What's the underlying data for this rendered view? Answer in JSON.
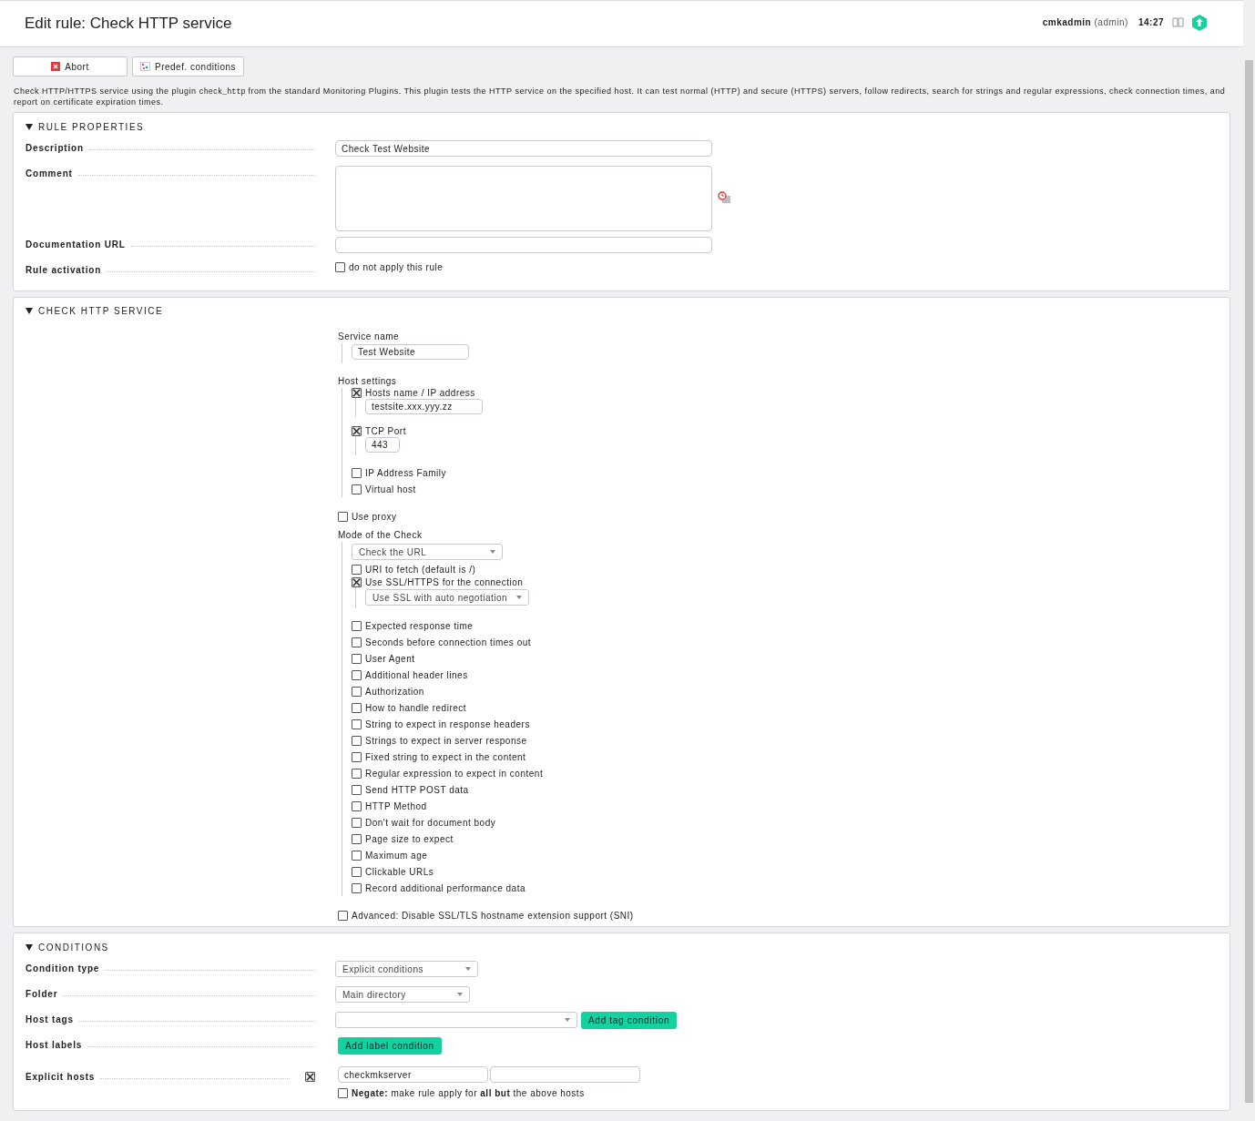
{
  "header": {
    "title": "Edit rule: Check HTTP service",
    "user": "cmkadmin",
    "role": "(admin)",
    "time": "14:27"
  },
  "buttons": [
    {
      "kind": "abort",
      "label": "Abort"
    },
    {
      "kind": "conditions",
      "label": "Predef. conditions"
    }
  ],
  "intro": {
    "before": "Check HTTP/HTTPS service using the plugin ",
    "code": "check_http",
    "after": " from the standard Monitoring Plugins. This plugin tests the HTTP service on the specified host. It can test normal (HTTP) and secure (HTTPS) servers, follow redirects, search for strings and regular expressions, check connection times, and report on certificate expiration times."
  },
  "rule_properties": {
    "title": "RULE PROPERTIES",
    "expanded": true,
    "description": {
      "label": "Description",
      "value": "Check Test Website"
    },
    "comment": {
      "label": "Comment"
    },
    "documentation_url": {
      "label": "Documentation URL"
    },
    "rule_activation": {
      "label": "Rule activation",
      "option": "do not apply this rule",
      "checked": false
    }
  },
  "check_http": {
    "title": "CHECK HTTP SERVICE",
    "expanded": true,
    "service_name": {
      "label": "Service name",
      "value": "Test Website"
    },
    "host_settings": {
      "label": "Host settings",
      "options": [
        {
          "label": "Hosts name / IP address",
          "checked": true,
          "value": "testsite.xxx.yyy.zz"
        },
        {
          "label": "TCP Port",
          "checked": true,
          "value": "443"
        },
        {
          "label": "IP Address Family",
          "checked": false
        },
        {
          "label": "Virtual host",
          "checked": false
        }
      ]
    },
    "use_proxy": {
      "label": "Use proxy",
      "checked": false
    },
    "mode": {
      "label": "Mode of the Check",
      "select": "Check the URL",
      "options": [
        {
          "label": "URI to fetch (default is /)",
          "checked": false
        },
        {
          "label": "Use SSL/HTTPS for the connection",
          "checked": true,
          "select": "Use SSL with auto negotiation"
        },
        {
          "label": "Expected response time",
          "checked": false
        },
        {
          "label": "Seconds before connection times out",
          "checked": false
        },
        {
          "label": "User Agent",
          "checked": false
        },
        {
          "label": "Additional header lines",
          "checked": false
        },
        {
          "label": "Authorization",
          "checked": false
        },
        {
          "label": "How to handle redirect",
          "checked": false
        },
        {
          "label": "String to expect in response headers",
          "checked": false
        },
        {
          "label": "Strings to expect in server response",
          "checked": false
        },
        {
          "label": "Fixed string to expect in the content",
          "checked": false
        },
        {
          "label": "Regular expression to expect in content",
          "checked": false
        },
        {
          "label": "Send HTTP POST data",
          "checked": false
        },
        {
          "label": "HTTP Method",
          "checked": false
        },
        {
          "label": "Don't wait for document body",
          "checked": false
        },
        {
          "label": "Page size to expect",
          "checked": false
        },
        {
          "label": "Maximum age",
          "checked": false
        },
        {
          "label": "Clickable URLs",
          "checked": false
        },
        {
          "label": "Record additional performance data",
          "checked": false
        }
      ]
    },
    "advanced": {
      "label": "Advanced: Disable SSL/TLS hostname extension support (SNI)",
      "checked": false
    }
  },
  "conditions": {
    "title": "CONDITIONS",
    "expanded": true,
    "rows": [
      {
        "kind": "select",
        "label": "Condition type",
        "value": "Explicit conditions"
      },
      {
        "kind": "select",
        "label": "Folder",
        "value": "Main directory"
      },
      {
        "kind": "select_button",
        "label": "Host tags",
        "button": "Add tag condition"
      },
      {
        "kind": "button",
        "label": "Host labels",
        "button": "Add label condition"
      },
      {
        "kind": "hosts",
        "label": "Explicit hosts",
        "checked": true,
        "values": [
          "checkmkserver"
        ],
        "negate": {
          "checked": false,
          "text": "**Negate:** make rule apply for **all but** the above hosts"
        }
      }
    ]
  }
}
